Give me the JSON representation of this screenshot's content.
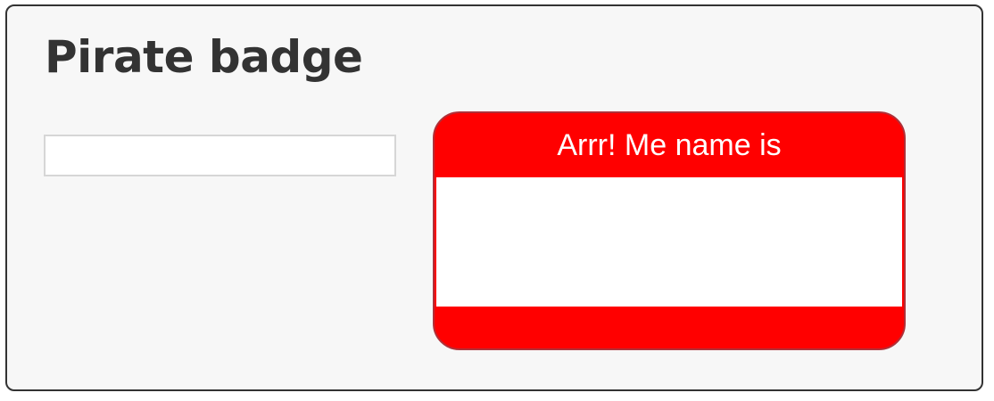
{
  "title": "Pirate badge",
  "input": {
    "value": "",
    "placeholder": ""
  },
  "badge": {
    "header": "Arrr! Me name is",
    "name": "",
    "accent_color": "#ff0000"
  }
}
